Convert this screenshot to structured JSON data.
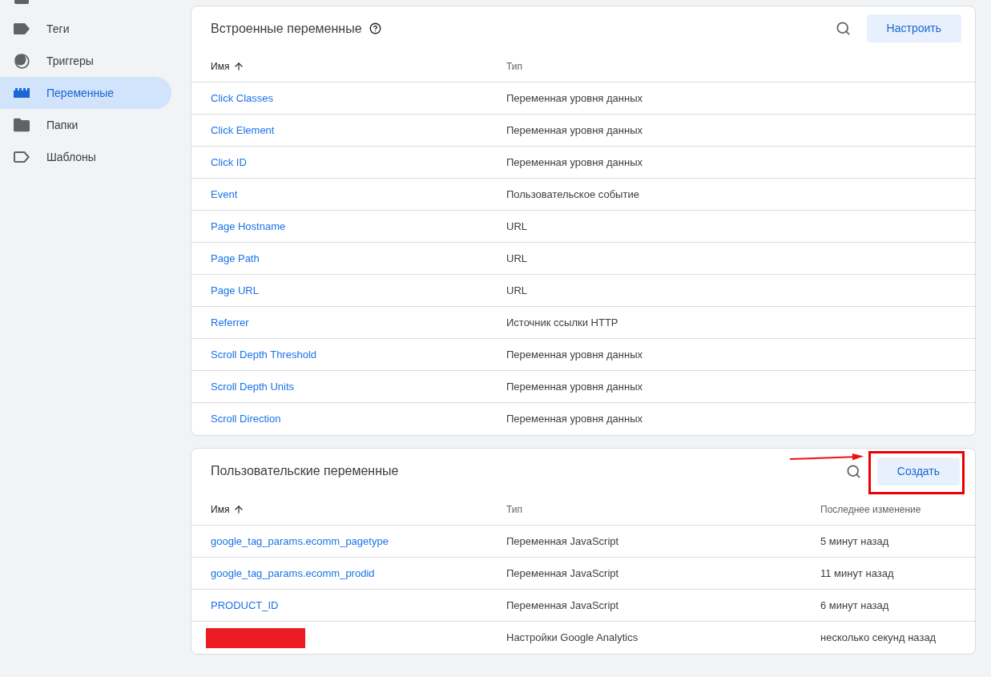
{
  "sidebar": {
    "items": [
      {
        "kind": "overview",
        "selected": false
      },
      {
        "kind": "tag",
        "label": "Теги",
        "selected": false
      },
      {
        "kind": "trigger",
        "label": "Триггеры",
        "selected": false
      },
      {
        "kind": "variable",
        "label": "Переменные",
        "selected": true
      },
      {
        "kind": "folder",
        "label": "Папки",
        "selected": false
      },
      {
        "kind": "template",
        "label": "Шаблоны",
        "selected": false
      }
    ]
  },
  "builtin_variables": {
    "title": "Встроенные переменные",
    "help": true,
    "button": "Настроить",
    "columns": [
      {
        "label": "Имя",
        "sorted": true
      },
      {
        "label": "Тип",
        "sorted": false
      }
    ],
    "rows": [
      {
        "kind": "link",
        "name": "Click Classes",
        "type": "Переменная уровня данных"
      },
      {
        "kind": "link",
        "name": "Click Element",
        "type": "Переменная уровня данных"
      },
      {
        "kind": "link",
        "name": "Click ID",
        "type": "Переменная уровня данных"
      },
      {
        "kind": "link",
        "name": "Event",
        "type": "Пользовательское событие"
      },
      {
        "kind": "link",
        "name": "Page Hostname",
        "type": "URL"
      },
      {
        "kind": "link",
        "name": "Page Path",
        "type": "URL"
      },
      {
        "kind": "link",
        "name": "Page URL",
        "type": "URL"
      },
      {
        "kind": "link",
        "name": "Referrer",
        "type": "Источник ссылки HTTP"
      },
      {
        "kind": "link",
        "name": "Scroll Depth Threshold",
        "type": "Переменная уровня данных"
      },
      {
        "kind": "link",
        "name": "Scroll Depth Units",
        "type": "Переменная уровня данных"
      },
      {
        "kind": "link",
        "name": "Scroll Direction",
        "type": "Переменная уровня данных"
      }
    ]
  },
  "user_variables": {
    "title": "Пользовательские переменные",
    "button": "Создать",
    "pointer_arrow": true,
    "highlight_box": true,
    "columns": [
      {
        "label": "Имя",
        "sorted": true
      },
      {
        "label": "Тип",
        "sorted": false
      },
      {
        "label": "Последнее изменение",
        "sorted": false
      }
    ],
    "rows": [
      {
        "kind": "link",
        "name": "google_tag_params.ecomm_pagetype",
        "type": "Переменная JavaScript",
        "modified": "5 минут назад"
      },
      {
        "kind": "link",
        "name": "google_tag_params.ecomm_prodid",
        "type": "Переменная JavaScript",
        "modified": "11 минут назад"
      },
      {
        "kind": "link",
        "name": "PRODUCT_ID",
        "type": "Переменная JavaScript",
        "modified": "6 минут назад"
      },
      {
        "kind": "redacted",
        "type": "Настройки Google Analytics",
        "modified": "несколько секунд назад"
      }
    ]
  }
}
